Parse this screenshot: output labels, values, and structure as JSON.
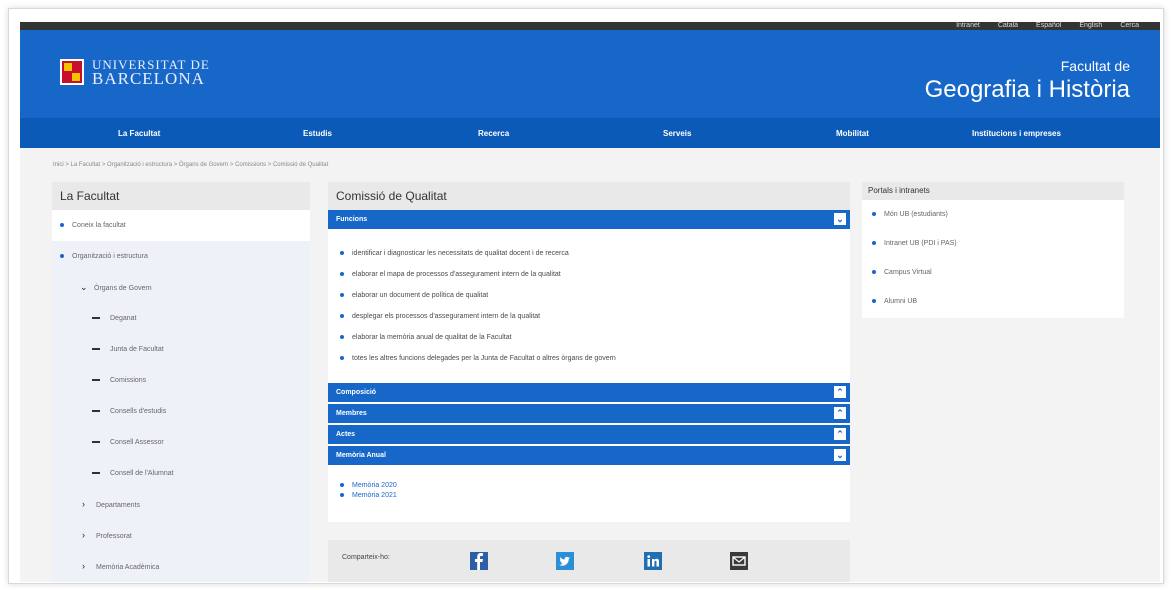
{
  "header": {
    "logo_line1": "UNIVERSITAT DE",
    "logo_line2": "BARCELONA",
    "faculty_line1": "Facultat de",
    "faculty_line2": "Geografia i Història",
    "top_links": [
      "Intranet",
      "Català",
      "Español",
      "English",
      "Cerca"
    ]
  },
  "nav": {
    "items": [
      "La Facultat",
      "Estudis",
      "Recerca",
      "Serveis",
      "Mobilitat",
      "Institucions i empreses"
    ]
  },
  "breadcrumb": "Inici > La Facultat > Organització i estructura > Òrgans de Govern > Comissions > Comissió de Qualitat",
  "sidebar": {
    "title": "La Facultat",
    "items": [
      {
        "label": "Conеix la facultat"
      },
      {
        "label": "Organització i estructura"
      },
      {
        "label": "Òrgans de Govern"
      },
      {
        "label": "Deganat"
      },
      {
        "label": "Junta de Facultat"
      },
      {
        "label": "Comissions"
      },
      {
        "label": "Consells d'estudis"
      },
      {
        "label": "Consell Assessor"
      },
      {
        "label": "Consell de l'Alumnat"
      },
      {
        "label": "Departaments"
      },
      {
        "label": "Professorat"
      },
      {
        "label": "Memòria Acadèmica"
      }
    ]
  },
  "main": {
    "title": "Comissió de Qualitat",
    "funcions_label": "Funcions",
    "funcions": [
      "identificar i diagnosticar les necessitats de qualitat docent i de recerca",
      "elaborar el mapa de processos d'assegurament intern de la qualitat",
      "elaborar un document de política de qualitat",
      "desplegar els processos d'assegurament intern de la qualitat",
      "elaborar la memòria anual de qualitat de la Facultat",
      "totes les altres funcions delegades per la Junta de Facultat o altres òrgans de govern"
    ],
    "sections": [
      "Composició",
      "Membres",
      "Actes",
      "Memòria Anual"
    ],
    "memories": [
      "Memòria 2020",
      "Memòria 2021"
    ],
    "share_label": "Comparteix-ho:"
  },
  "right_panel": {
    "title": "Portals i intranets",
    "items": [
      "Món UB (estudiants)",
      "Intranet UB (PDI i PAS)",
      "Campus Virtual",
      "Alumni UB"
    ]
  },
  "colors": {
    "primary": "#1767c9",
    "nav": "#0c5ab8",
    "panel": "#e9e9e9"
  }
}
